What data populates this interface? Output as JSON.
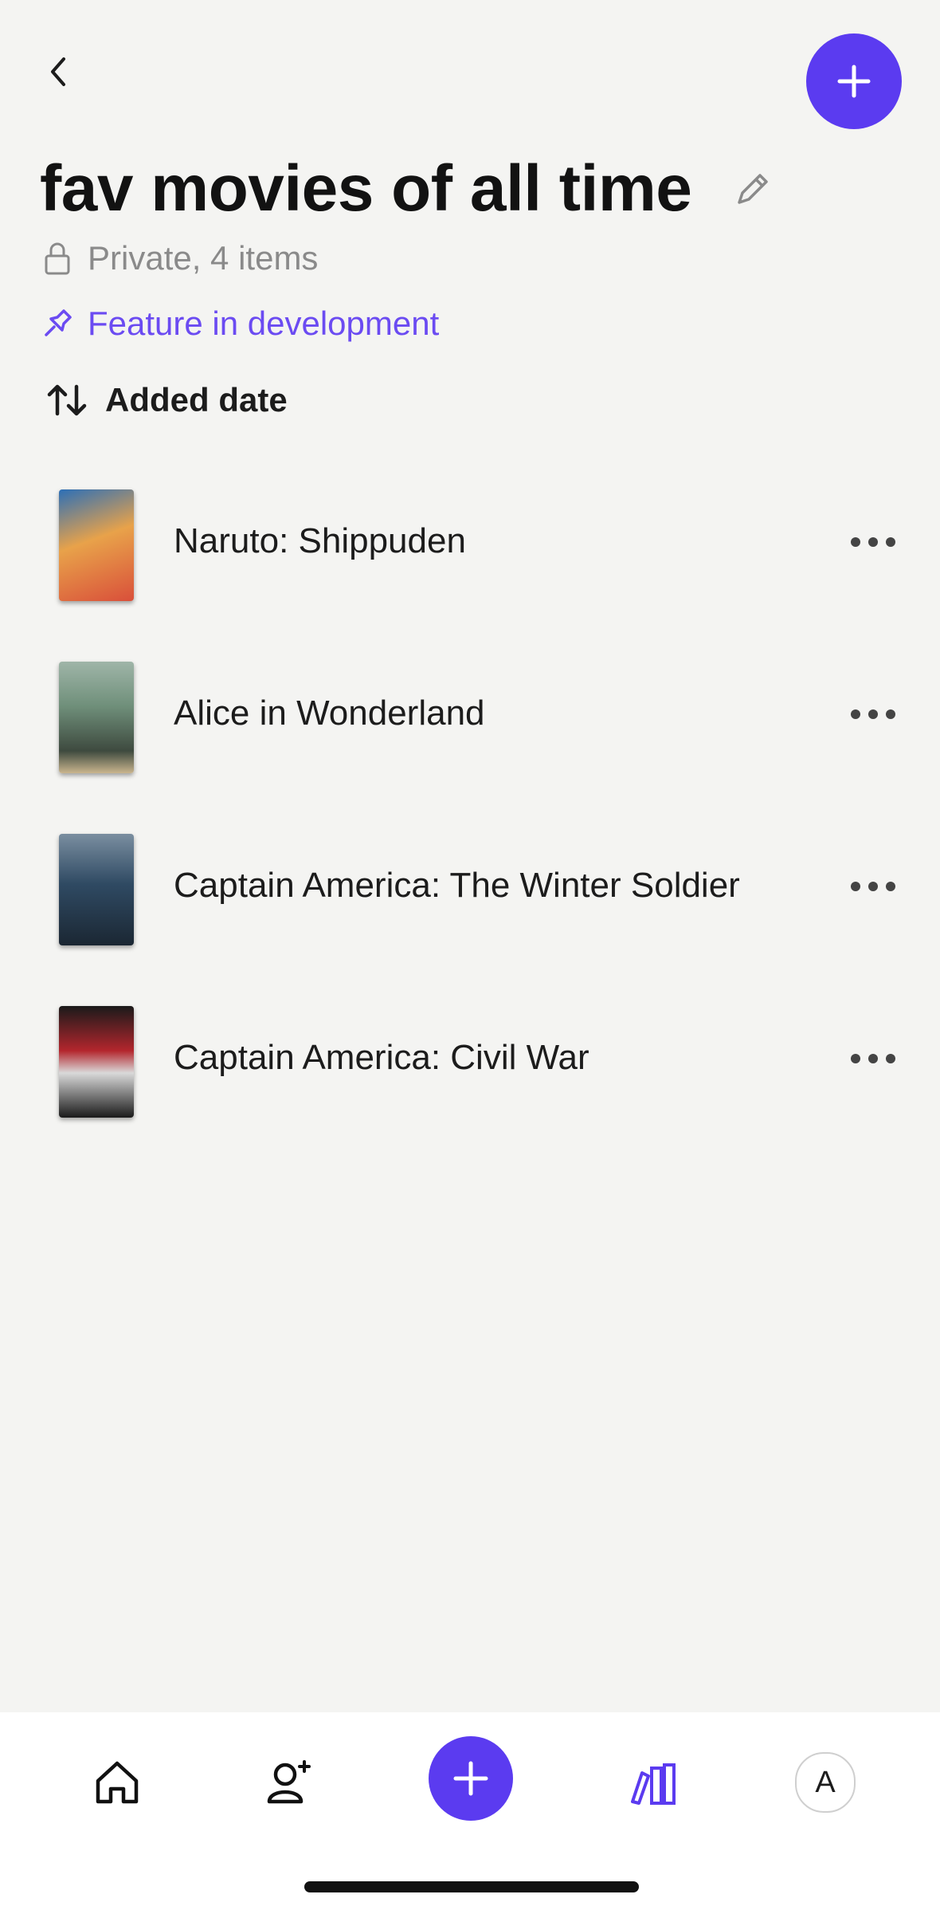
{
  "header": {
    "back_icon": "chevron-left-icon",
    "add_icon": "plus-icon",
    "accent": "#5b3bf0"
  },
  "list_info": {
    "title": "fav movies of all time",
    "edit_icon": "pencil-icon",
    "privacy_icon": "lock-icon",
    "meta": "Private, 4 items",
    "feature_icon": "pin-icon",
    "feature_text": "Feature in development",
    "sort_icon": "sort-arrows-icon",
    "sort_label": "Added date"
  },
  "items": [
    {
      "title": "Naruto: Shippuden",
      "poster_colors": [
        "#e8a24a",
        "#2c6fb7",
        "#d94f3a"
      ]
    },
    {
      "title": "Alice in Wonderland",
      "poster_colors": [
        "#6f8f7a",
        "#3e4a3f",
        "#c9b58e"
      ]
    },
    {
      "title": "Captain America: The Winter Soldier",
      "poster_colors": [
        "#2f4a63",
        "#1b2733",
        "#7a8ea0"
      ]
    },
    {
      "title": "Captain America: Civil War",
      "poster_colors": [
        "#1a1a1a",
        "#b3262d",
        "#d9d9d9"
      ]
    }
  ],
  "tabbar": {
    "home_icon": "home-icon",
    "add_friend_icon": "add-friend-icon",
    "plus_icon": "plus-icon",
    "library_icon": "library-icon",
    "avatar_letter": "A"
  }
}
